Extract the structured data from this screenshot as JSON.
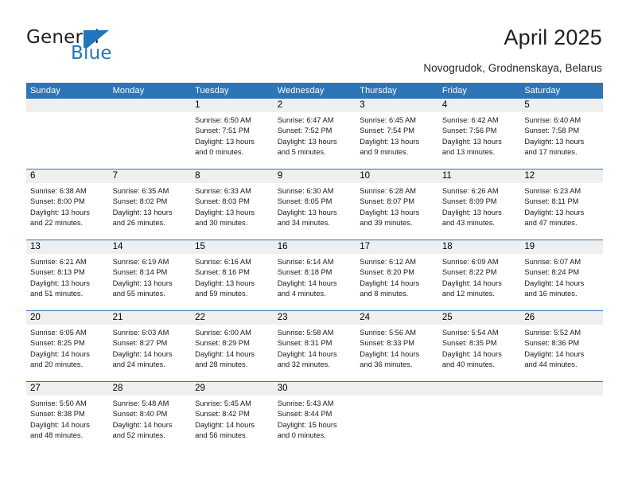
{
  "brand": {
    "name_part1": "General",
    "name_part2": "Blue",
    "flag_icon": "general-blue-flag-logo"
  },
  "header": {
    "title": "April 2025",
    "subtitle": "Novogrudok, Grodnenskaya, Belarus"
  },
  "colors": {
    "header_blue": "#2e75b6",
    "brand_blue": "#1f76bc",
    "date_band": "#efefef",
    "text": "#000000"
  },
  "calendar": {
    "weekdays": [
      "Sunday",
      "Monday",
      "Tuesday",
      "Wednesday",
      "Thursday",
      "Friday",
      "Saturday"
    ],
    "weeks": [
      [
        {
          "day": "",
          "lines": []
        },
        {
          "day": "",
          "lines": []
        },
        {
          "day": "1",
          "lines": [
            "Sunrise: 6:50 AM",
            "Sunset: 7:51 PM",
            "Daylight: 13 hours",
            "and 0 minutes."
          ]
        },
        {
          "day": "2",
          "lines": [
            "Sunrise: 6:47 AM",
            "Sunset: 7:52 PM",
            "Daylight: 13 hours",
            "and 5 minutes."
          ]
        },
        {
          "day": "3",
          "lines": [
            "Sunrise: 6:45 AM",
            "Sunset: 7:54 PM",
            "Daylight: 13 hours",
            "and 9 minutes."
          ]
        },
        {
          "day": "4",
          "lines": [
            "Sunrise: 6:42 AM",
            "Sunset: 7:56 PM",
            "Daylight: 13 hours",
            "and 13 minutes."
          ]
        },
        {
          "day": "5",
          "lines": [
            "Sunrise: 6:40 AM",
            "Sunset: 7:58 PM",
            "Daylight: 13 hours",
            "and 17 minutes."
          ]
        }
      ],
      [
        {
          "day": "6",
          "lines": [
            "Sunrise: 6:38 AM",
            "Sunset: 8:00 PM",
            "Daylight: 13 hours",
            "and 22 minutes."
          ]
        },
        {
          "day": "7",
          "lines": [
            "Sunrise: 6:35 AM",
            "Sunset: 8:02 PM",
            "Daylight: 13 hours",
            "and 26 minutes."
          ]
        },
        {
          "day": "8",
          "lines": [
            "Sunrise: 6:33 AM",
            "Sunset: 8:03 PM",
            "Daylight: 13 hours",
            "and 30 minutes."
          ]
        },
        {
          "day": "9",
          "lines": [
            "Sunrise: 6:30 AM",
            "Sunset: 8:05 PM",
            "Daylight: 13 hours",
            "and 34 minutes."
          ]
        },
        {
          "day": "10",
          "lines": [
            "Sunrise: 6:28 AM",
            "Sunset: 8:07 PM",
            "Daylight: 13 hours",
            "and 39 minutes."
          ]
        },
        {
          "day": "11",
          "lines": [
            "Sunrise: 6:26 AM",
            "Sunset: 8:09 PM",
            "Daylight: 13 hours",
            "and 43 minutes."
          ]
        },
        {
          "day": "12",
          "lines": [
            "Sunrise: 6:23 AM",
            "Sunset: 8:11 PM",
            "Daylight: 13 hours",
            "and 47 minutes."
          ]
        }
      ],
      [
        {
          "day": "13",
          "lines": [
            "Sunrise: 6:21 AM",
            "Sunset: 8:13 PM",
            "Daylight: 13 hours",
            "and 51 minutes."
          ]
        },
        {
          "day": "14",
          "lines": [
            "Sunrise: 6:19 AM",
            "Sunset: 8:14 PM",
            "Daylight: 13 hours",
            "and 55 minutes."
          ]
        },
        {
          "day": "15",
          "lines": [
            "Sunrise: 6:16 AM",
            "Sunset: 8:16 PM",
            "Daylight: 13 hours",
            "and 59 minutes."
          ]
        },
        {
          "day": "16",
          "lines": [
            "Sunrise: 6:14 AM",
            "Sunset: 8:18 PM",
            "Daylight: 14 hours",
            "and 4 minutes."
          ]
        },
        {
          "day": "17",
          "lines": [
            "Sunrise: 6:12 AM",
            "Sunset: 8:20 PM",
            "Daylight: 14 hours",
            "and 8 minutes."
          ]
        },
        {
          "day": "18",
          "lines": [
            "Sunrise: 6:09 AM",
            "Sunset: 8:22 PM",
            "Daylight: 14 hours",
            "and 12 minutes."
          ]
        },
        {
          "day": "19",
          "lines": [
            "Sunrise: 6:07 AM",
            "Sunset: 8:24 PM",
            "Daylight: 14 hours",
            "and 16 minutes."
          ]
        }
      ],
      [
        {
          "day": "20",
          "lines": [
            "Sunrise: 6:05 AM",
            "Sunset: 8:25 PM",
            "Daylight: 14 hours",
            "and 20 minutes."
          ]
        },
        {
          "day": "21",
          "lines": [
            "Sunrise: 6:03 AM",
            "Sunset: 8:27 PM",
            "Daylight: 14 hours",
            "and 24 minutes."
          ]
        },
        {
          "day": "22",
          "lines": [
            "Sunrise: 6:00 AM",
            "Sunset: 8:29 PM",
            "Daylight: 14 hours",
            "and 28 minutes."
          ]
        },
        {
          "day": "23",
          "lines": [
            "Sunrise: 5:58 AM",
            "Sunset: 8:31 PM",
            "Daylight: 14 hours",
            "and 32 minutes."
          ]
        },
        {
          "day": "24",
          "lines": [
            "Sunrise: 5:56 AM",
            "Sunset: 8:33 PM",
            "Daylight: 14 hours",
            "and 36 minutes."
          ]
        },
        {
          "day": "25",
          "lines": [
            "Sunrise: 5:54 AM",
            "Sunset: 8:35 PM",
            "Daylight: 14 hours",
            "and 40 minutes."
          ]
        },
        {
          "day": "26",
          "lines": [
            "Sunrise: 5:52 AM",
            "Sunset: 8:36 PM",
            "Daylight: 14 hours",
            "and 44 minutes."
          ]
        }
      ],
      [
        {
          "day": "27",
          "lines": [
            "Sunrise: 5:50 AM",
            "Sunset: 8:38 PM",
            "Daylight: 14 hours",
            "and 48 minutes."
          ]
        },
        {
          "day": "28",
          "lines": [
            "Sunrise: 5:48 AM",
            "Sunset: 8:40 PM",
            "Daylight: 14 hours",
            "and 52 minutes."
          ]
        },
        {
          "day": "29",
          "lines": [
            "Sunrise: 5:45 AM",
            "Sunset: 8:42 PM",
            "Daylight: 14 hours",
            "and 56 minutes."
          ]
        },
        {
          "day": "30",
          "lines": [
            "Sunrise: 5:43 AM",
            "Sunset: 8:44 PM",
            "Daylight: 15 hours",
            "and 0 minutes."
          ]
        },
        {
          "day": "",
          "lines": []
        },
        {
          "day": "",
          "lines": []
        },
        {
          "day": "",
          "lines": []
        }
      ]
    ]
  }
}
